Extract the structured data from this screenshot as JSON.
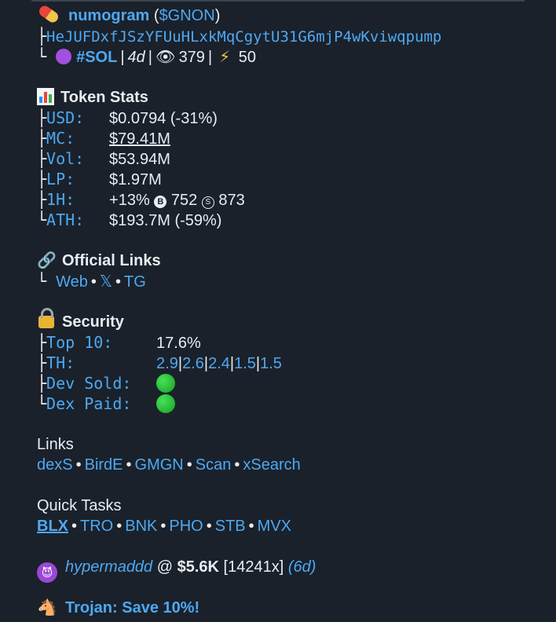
{
  "header": {
    "name": "numogram",
    "ticker_prefix": " (",
    "ticker": "$GNON",
    "ticker_suffix": ")",
    "address": "HeJUFDxfJSzYFUuHLxkMqCgytU31G6mjP4wKviwqpump",
    "chain": "#SOL",
    "age": "4d",
    "views": "379",
    "bolts": "50"
  },
  "token_stats": {
    "title": "Token Stats",
    "rows": [
      {
        "label": "USD:",
        "value": "$0.0794",
        "extra": " (-31%)"
      },
      {
        "label": "MC:",
        "value": "$79.41M",
        "extra": ""
      },
      {
        "label": "Vol:",
        "value": "$53.94M",
        "extra": ""
      },
      {
        "label": "LP:",
        "value": "$1.97M",
        "extra": ""
      },
      {
        "label": "1H:",
        "value": "+13%",
        "buys": "752",
        "sells": "873"
      },
      {
        "label": "ATH:",
        "value": "$193.7M",
        "extra": " (-59%)"
      }
    ],
    "buy_glyph": "B",
    "sell_glyph": "S"
  },
  "official_links": {
    "title": "Official Links",
    "items": [
      "Web",
      "𝕏",
      "TG"
    ]
  },
  "security": {
    "title": "Security",
    "top10_label": "Top 10:",
    "top10_value": "17.6%",
    "th_label": "TH:",
    "th_values": [
      "2.9",
      "2.6",
      "2.4",
      "1.5",
      "1.5"
    ],
    "dev_sold_label": "Dev Sold:",
    "dex_paid_label": "Dex Paid:",
    "status_color": "#22c232"
  },
  "links": {
    "title": "Links",
    "items": [
      "dexS",
      "BirdE",
      "GMGN",
      "Scan",
      "xSearch"
    ]
  },
  "quick_tasks": {
    "title": "Quick Tasks",
    "items": [
      "BLX",
      "TRO",
      "BNK",
      "PHO",
      "STB",
      "MVX"
    ]
  },
  "caller": {
    "name": "hypermaddd",
    "at": " @ ",
    "amount": "$5.6K",
    "multiple": "[14241x]",
    "age": "(6d)"
  },
  "promo": {
    "text": "Trojan: Save 10%!"
  },
  "colors": {
    "background": "#1a212a",
    "link": "#4ea8f2",
    "text": "#e9edf1",
    "sol_dot": "#a34fe0"
  },
  "icons": {
    "pill": "pill-icon",
    "chart": "bar-chart-icon",
    "link": "chain-link-icon",
    "lock": "lock-icon",
    "devil": "smiling-devil-icon",
    "horse": "horse-icon",
    "eye": "eye-icon",
    "bolt": "lightning-icon"
  }
}
